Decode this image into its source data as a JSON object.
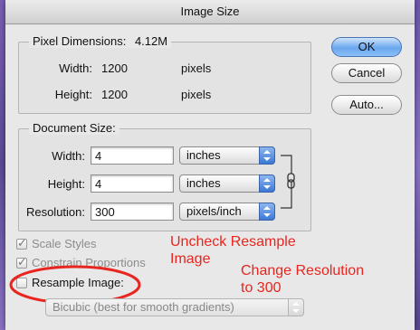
{
  "window": {
    "title": "Image Size"
  },
  "pixel_dimensions": {
    "title": "Pixel Dimensions:",
    "size": "4.12M",
    "width_label": "Width:",
    "width_value": "1200",
    "width_unit": "pixels",
    "height_label": "Height:",
    "height_value": "1200",
    "height_unit": "pixels"
  },
  "document_size": {
    "title": "Document Size:",
    "width_label": "Width:",
    "width_value": "4",
    "width_unit": "inches",
    "height_label": "Height:",
    "height_value": "4",
    "height_unit": "inches",
    "resolution_label": "Resolution:",
    "resolution_value": "300",
    "resolution_unit": "pixels/inch"
  },
  "options": {
    "scale_styles": {
      "label": "Scale Styles",
      "checked": true,
      "enabled": false
    },
    "constrain_proportions": {
      "label": "Constrain Proportions",
      "checked": true,
      "enabled": false
    },
    "resample_image": {
      "label": "Resample Image:",
      "checked": false,
      "enabled": true
    },
    "resample_method": "Bicubic (best for smooth gradients)"
  },
  "buttons": {
    "ok": "OK",
    "cancel": "Cancel",
    "auto": "Auto..."
  },
  "annotations": {
    "uncheck_resample_1": "Uncheck Resample",
    "uncheck_resample_2": "Image",
    "change_resolution_1": "Change Resolution",
    "change_resolution_2": "to 300",
    "highlight_color": "#e8251e"
  }
}
